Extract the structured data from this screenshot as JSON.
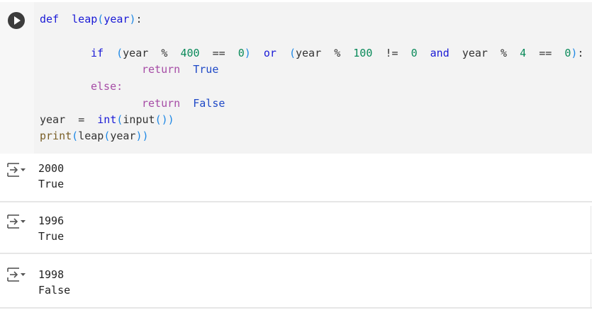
{
  "cell": {
    "run_button": "run",
    "code": {
      "l1_def": "def",
      "l1_name": "leap",
      "l1_open": "(",
      "l1_param": "year",
      "l1_close": ")",
      "l1_colon": ":",
      "l3_if": "if",
      "l3_p1": "(",
      "l3_year1": "year",
      "l3_mod1": "%",
      "l3_n400": "400",
      "l3_eq1": "==",
      "l3_z1": "0",
      "l3_p2": ")",
      "l3_or": "or",
      "l3_p3": "(",
      "l3_year2": "year",
      "l3_mod2": "%",
      "l3_n100": "100",
      "l3_ne": "!=",
      "l3_z2": "0",
      "l3_and": "and",
      "l3_year3": "year",
      "l3_mod3": "%",
      "l3_n4": "4",
      "l3_eq2": "==",
      "l3_z3": "0",
      "l3_p4": ")",
      "l3_colon": ":",
      "l4_return": "return",
      "l4_true": "True",
      "l5_else": "else:",
      "l6_return": "return",
      "l6_false": "False",
      "l7_year": "year",
      "l7_eq": "=",
      "l7_int": "int",
      "l7_p1": "(",
      "l7_input": "input",
      "l7_p2": "()",
      "l7_p3": ")",
      "l8_print": "print",
      "l8_p1": "(",
      "l8_leap": "leap",
      "l8_p2": "(",
      "l8_year": "year",
      "l8_p3": "))"
    }
  },
  "outputs": [
    {
      "input": "2000",
      "result": "True"
    },
    {
      "input": "1996",
      "result": "True"
    },
    {
      "input": "1998",
      "result": "False"
    }
  ],
  "colors": {
    "keyword": "#1a1ad6",
    "number": "#0a8a5a",
    "boolean": "#1f49c7",
    "control": "#a64ca6",
    "editor_bg": "#f3f3f3"
  }
}
